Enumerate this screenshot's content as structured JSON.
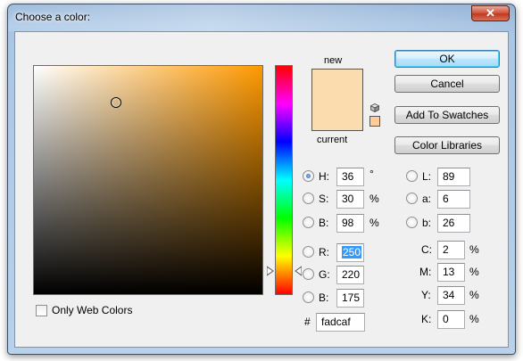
{
  "window": {
    "title": "Choose a color:",
    "close_glyph": "✕"
  },
  "preview": {
    "new_label": "new",
    "current_label": "current",
    "new_color": "#fadcaf",
    "current_color": "#fadcaf"
  },
  "buttons": {
    "ok": "OK",
    "cancel": "Cancel",
    "add_swatches": "Add To Swatches",
    "color_libraries": "Color Libraries"
  },
  "hsb": {
    "h": {
      "label": "H:",
      "value": "36",
      "unit": "°",
      "selected": true
    },
    "s": {
      "label": "S:",
      "value": "30",
      "unit": "%"
    },
    "b": {
      "label": "B:",
      "value": "98",
      "unit": "%"
    }
  },
  "lab": {
    "l": {
      "label": "L:",
      "value": "89"
    },
    "a": {
      "label": "a:",
      "value": "6"
    },
    "b": {
      "label": "b:",
      "value": "26"
    }
  },
  "rgb": {
    "r": {
      "label": "R:",
      "value": "250"
    },
    "g": {
      "label": "G:",
      "value": "220"
    },
    "b": {
      "label": "B:",
      "value": "175"
    }
  },
  "cmyk": {
    "c": {
      "label": "C:",
      "value": "2",
      "unit": "%"
    },
    "m": {
      "label": "M:",
      "value": "13",
      "unit": "%"
    },
    "y": {
      "label": "Y:",
      "value": "34",
      "unit": "%"
    },
    "k": {
      "label": "K:",
      "value": "0",
      "unit": "%"
    }
  },
  "hex": {
    "label": "#",
    "value": "fadcaf"
  },
  "only_web_colors": {
    "label": "Only Web Colors",
    "checked": false
  },
  "icons": {
    "gamut_warning": "cube-icon",
    "web_safe": "web-safe-chip"
  }
}
